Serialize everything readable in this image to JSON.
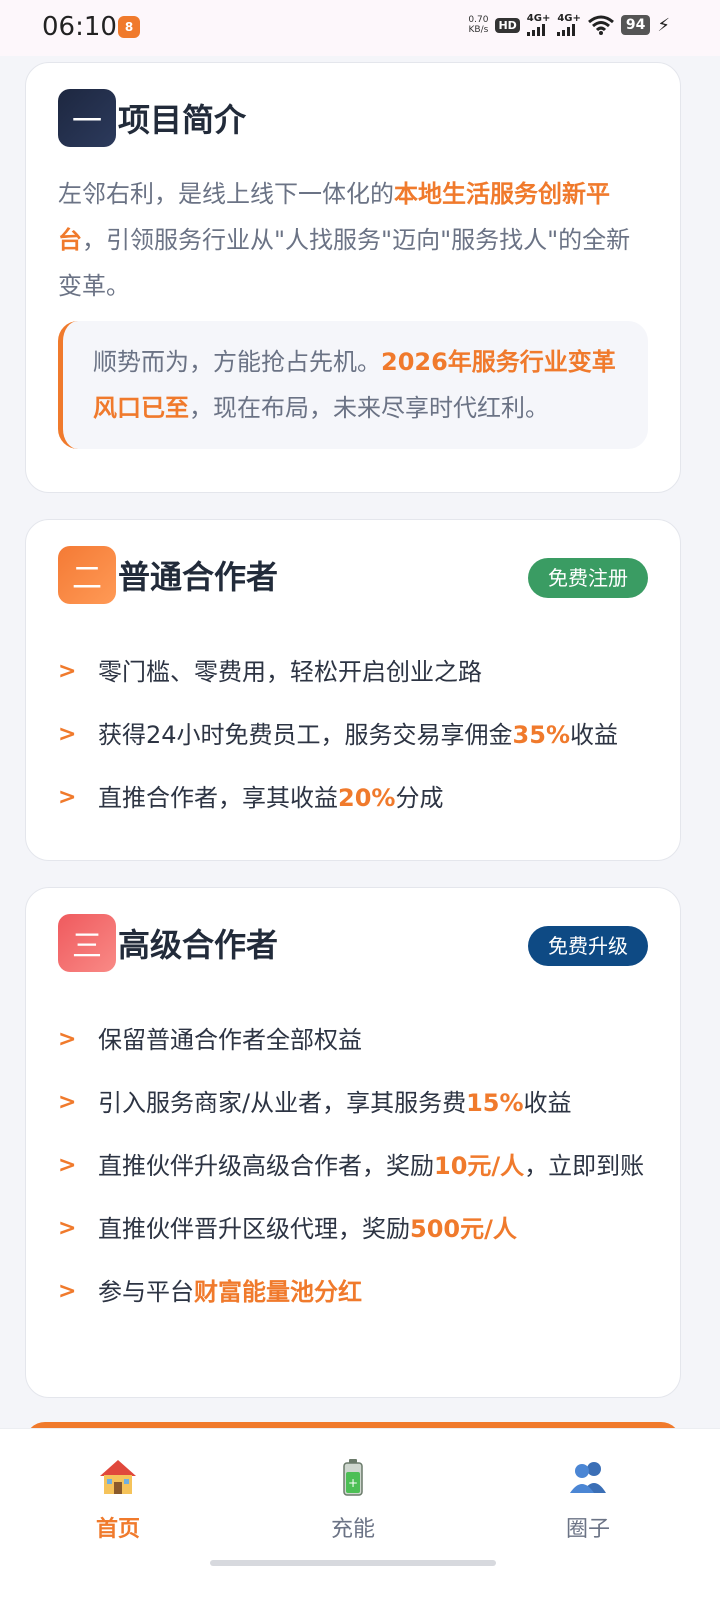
{
  "status_bar": {
    "time": "06:10",
    "app_icon_glyph": "8",
    "net_speed_value": "0.70",
    "net_speed_unit": "KB/s",
    "hd_badge": "HD",
    "sim1": "4G+",
    "sim2": "4G+",
    "battery": "94"
  },
  "section1": {
    "number": "一",
    "title": "项目简介",
    "intro_pre": "左邻右利，是线上线下一体化的",
    "intro_hl": "本地生活服务创新平台",
    "intro_post": "，引领服务行业从\"人找服务\"迈向\"服务找人\"的全新变革。",
    "quote_pre": "顺势而为，方能抢占先机。",
    "quote_hl": "2026年服务行业变革风口已至",
    "quote_post": "，现在布局，未来尽享时代红利。",
    "number_color": "#1d2740"
  },
  "section2": {
    "number": "二",
    "title": "普通合作者",
    "badge": "免费注册",
    "badge_color": "#3a9c63",
    "number_color": "#f47a35",
    "items": [
      {
        "pre": "零门槛、零费用，轻松开启创业之路",
        "hl": "",
        "post": ""
      },
      {
        "pre": "获得24小时免费员工，服务交易享佣金",
        "hl": "35%",
        "post": "收益"
      },
      {
        "pre": "直推合作者，享其收益",
        "hl": "20%",
        "post": "分成"
      }
    ]
  },
  "section3": {
    "number": "三",
    "title": "高级合作者",
    "badge": "免费升级",
    "badge_color": "#0e4a84",
    "number_color": "#ef5a5e",
    "items": [
      {
        "pre": "保留普通合作者全部权益",
        "hl": "",
        "post": ""
      },
      {
        "pre": "引入服务商家/从业者，享其服务费",
        "hl": "15%",
        "post": "收益"
      },
      {
        "pre": "直推伙伴升级高级合作者，奖励",
        "hl": "10元/人",
        "post": "，立即到账"
      },
      {
        "pre": "直推伙伴晋升区级代理，奖励",
        "hl": "500元/人",
        "post": ""
      },
      {
        "pre": "参与平台",
        "hl": "财富能量池分红",
        "post": ""
      }
    ]
  },
  "list_marker": ">",
  "bottom_nav": [
    {
      "label": "首页",
      "icon": "home-icon",
      "active": true
    },
    {
      "label": "充能",
      "icon": "battery-icon",
      "active": false
    },
    {
      "label": "圈子",
      "icon": "people-icon",
      "active": false
    }
  ],
  "colors": {
    "accent": "#f07a2c"
  }
}
